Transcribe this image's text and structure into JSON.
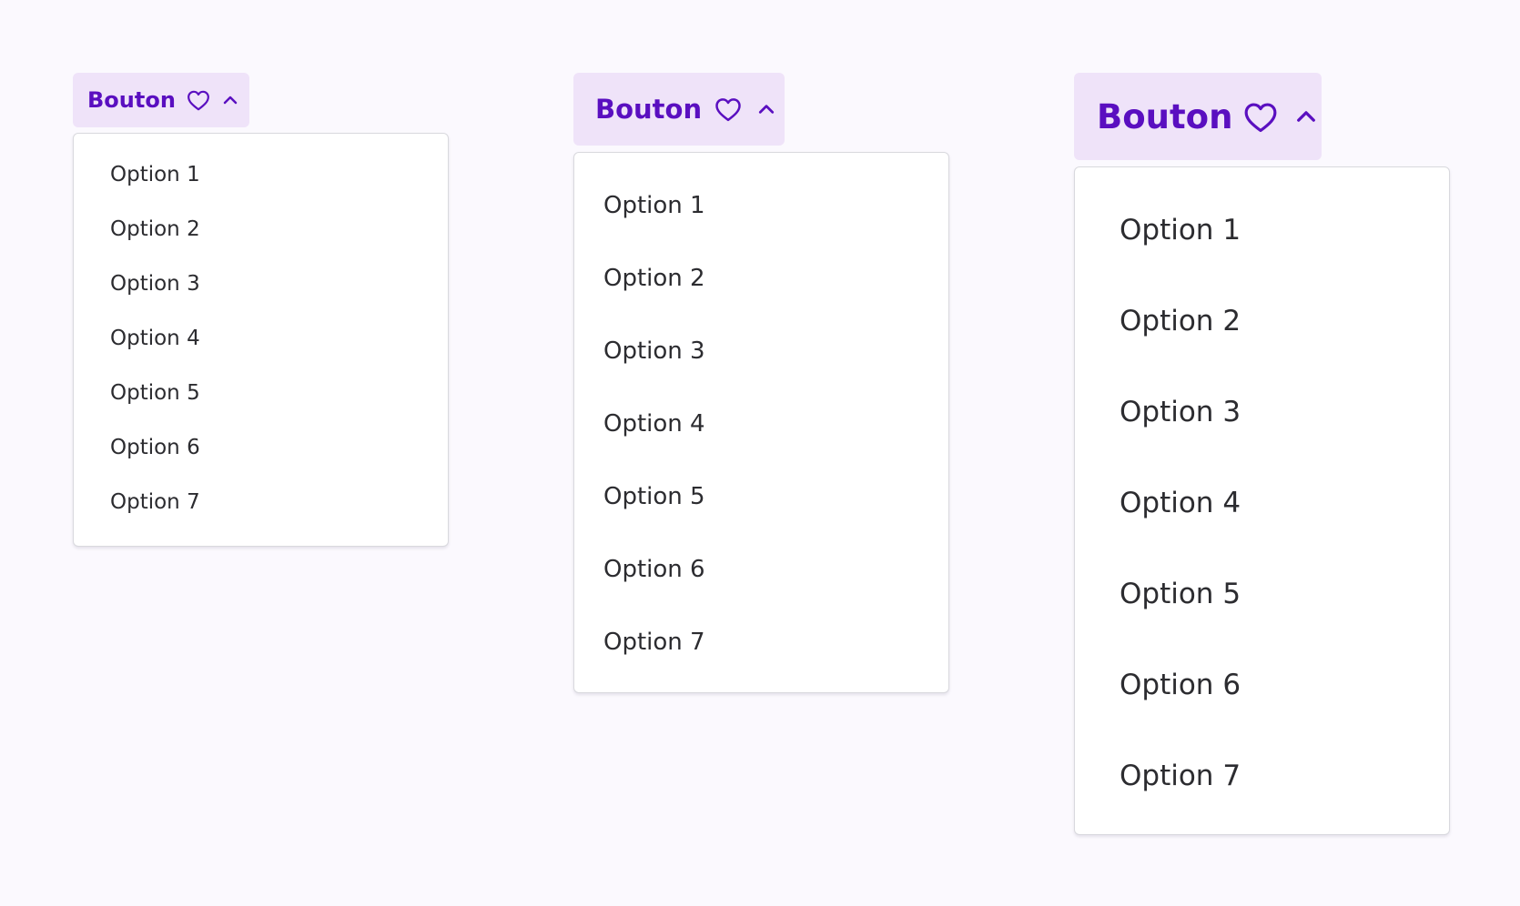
{
  "colors": {
    "background": "#fbf9fe",
    "button_background": "#efe3f9",
    "button_text": "#5a0fc0",
    "menu_background": "#ffffff",
    "menu_border": "#d9d9de",
    "item_text": "#2c2c30"
  },
  "dropdowns": [
    {
      "size": "small",
      "button": {
        "label": "Bouton",
        "icon": "heart-icon",
        "chevron": "chevron-up-icon"
      },
      "options": [
        "Option 1",
        "Option 2",
        "Option 3",
        "Option 4",
        "Option 5",
        "Option 6",
        "Option 7"
      ]
    },
    {
      "size": "medium",
      "button": {
        "label": "Bouton",
        "icon": "heart-icon",
        "chevron": "chevron-up-icon"
      },
      "options": [
        "Option 1",
        "Option 2",
        "Option 3",
        "Option 4",
        "Option 5",
        "Option 6",
        "Option 7"
      ]
    },
    {
      "size": "large",
      "button": {
        "label": "Bouton",
        "icon": "heart-icon",
        "chevron": "chevron-up-icon"
      },
      "options": [
        "Option 1",
        "Option 2",
        "Option 3",
        "Option 4",
        "Option 5",
        "Option 6",
        "Option 7"
      ]
    }
  ]
}
